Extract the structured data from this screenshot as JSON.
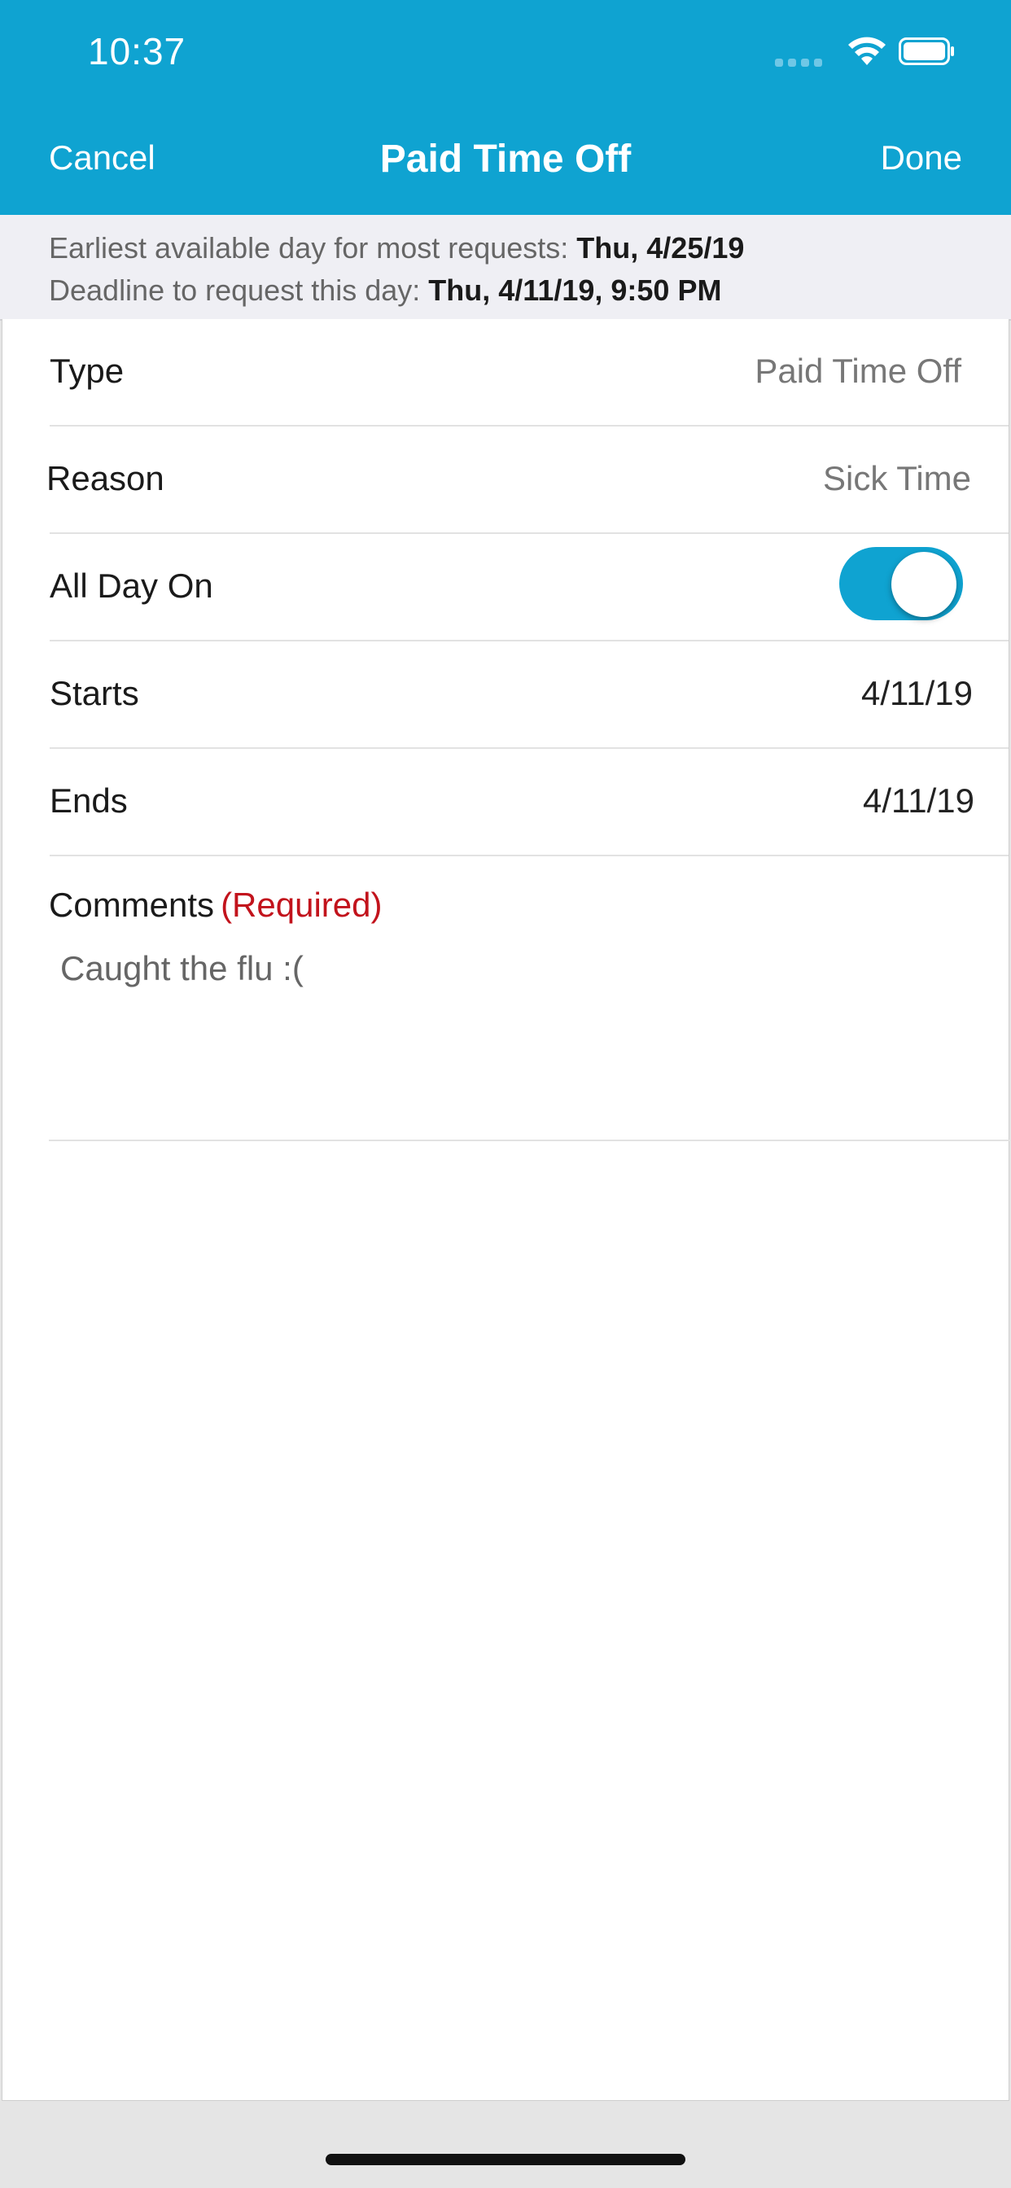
{
  "status_bar": {
    "time": "10:37"
  },
  "nav": {
    "cancel": "Cancel",
    "title": "Paid Time Off",
    "done": "Done"
  },
  "info": {
    "earliest_label": "Earliest available day for most requests:",
    "earliest_value": "Thu, 4/25/19",
    "deadline_label": "Deadline to request this day:",
    "deadline_value": "Thu, 4/11/19, 9:50 PM"
  },
  "form": {
    "type": {
      "label": "Type",
      "value": "Paid Time Off"
    },
    "reason": {
      "label": "Reason",
      "value": "Sick Time"
    },
    "all_day": {
      "label": "All Day On",
      "on": true
    },
    "starts": {
      "label": "Starts",
      "value": "4/11/19"
    },
    "ends": {
      "label": "Ends",
      "value": "4/11/19"
    },
    "comments": {
      "label": "Comments",
      "required": "(Required)",
      "value": "Caught the flu :("
    }
  },
  "colors": {
    "brand": "#0fa3d1",
    "required": "#c2131c"
  },
  "icons": {
    "wifi": "wifi-icon",
    "battery": "battery-icon",
    "signal": "signal-icon"
  }
}
